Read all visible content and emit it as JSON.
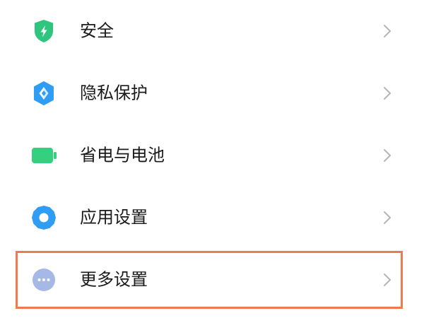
{
  "settings_list": {
    "items": [
      {
        "label": "安全",
        "icon": "shield-bolt-icon",
        "icon_color": "#2fc57e"
      },
      {
        "label": "隐私保护",
        "icon": "privacy-shield-icon",
        "icon_color": "#2f9df4"
      },
      {
        "label": "省电与电池",
        "icon": "battery-icon",
        "icon_color": "#35d07f"
      },
      {
        "label": "应用设置",
        "icon": "gear-icon",
        "icon_color": "#2f9df4"
      },
      {
        "label": "更多设置",
        "icon": "more-dots-icon",
        "icon_color": "#a5b8e6"
      }
    ],
    "chevron_icon": "chevron-right-icon",
    "highlight": {
      "item_label": "更多设置",
      "color": "#ee7a4f"
    }
  }
}
